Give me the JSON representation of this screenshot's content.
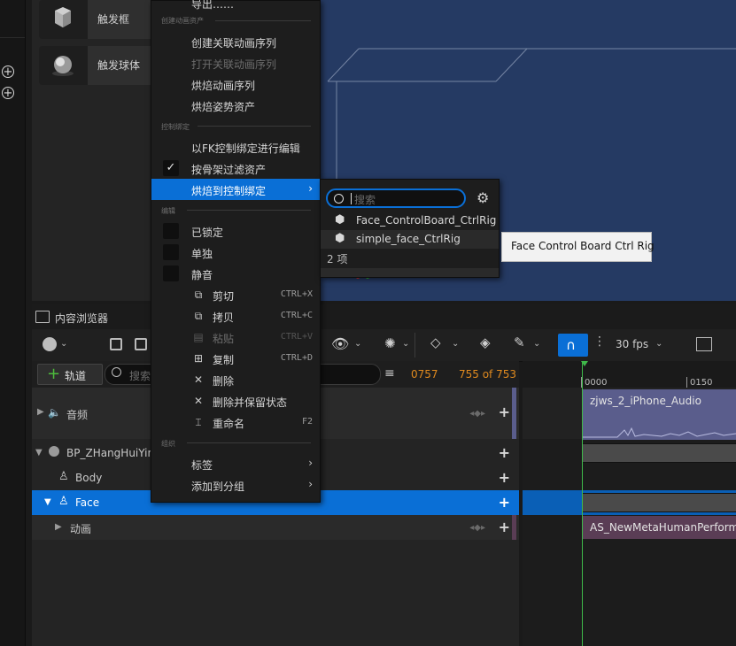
{
  "place_actors": {
    "items": [
      {
        "label": "触发框"
      },
      {
        "label": "触发球体"
      }
    ]
  },
  "content_browser": {
    "tab_label": "内容浏览器"
  },
  "sequencer": {
    "add_track_label": "轨道",
    "search_placeholder": "搜索",
    "frame_current": "0757",
    "frame_count": "755 of 753",
    "fps_label": "30 fps",
    "ruler": {
      "tick_0": "0000",
      "tick_1": "0150"
    },
    "tracks": [
      {
        "label": "音频"
      },
      {
        "label": "BP_ZHangHuiYin"
      },
      {
        "label": "Body"
      },
      {
        "label": "Face"
      },
      {
        "label": "动画"
      }
    ],
    "clips": {
      "audio": "zjws_2_iPhone_Audio",
      "anim": "AS_NewMetaHumanPerform"
    }
  },
  "context_menu": {
    "top_cut_label": "导出……",
    "sections": {
      "anim_assets": "创建动画资产",
      "control_rig": "控制绑定",
      "edit": "编辑",
      "organize": "组织"
    },
    "items": {
      "create_linked_seq": "创建关联动画序列",
      "open_linked_seq": "打开关联动画序列",
      "bake_anim_seq": "烘焙动画序列",
      "bake_pose_asset": "烘焙姿势资产",
      "edit_with_fk": "以FK控制绑定进行编辑",
      "filter_by_skeleton": "按骨架过滤资产",
      "bake_to_control_rig": "烘焙到控制绑定",
      "locked": "已锁定",
      "solo": "单独",
      "mute": "静音",
      "cut": "剪切",
      "copy": "拷贝",
      "paste": "粘贴",
      "duplicate": "复制",
      "delete": "删除",
      "delete_keep_state": "删除并保留状态",
      "rename": "重命名",
      "tags": "标签",
      "add_to_group": "添加到分组"
    },
    "shortcuts": {
      "cut": "CTRL+X",
      "copy": "CTRL+C",
      "paste": "CTRL+V",
      "duplicate": "CTRL+D",
      "rename": "F2"
    }
  },
  "submenu": {
    "search_placeholder": "搜索",
    "items": [
      {
        "label": "Face_ControlBoard_CtrlRig"
      },
      {
        "label": "simple_face_CtrlRig"
      }
    ],
    "count_label": "2 项"
  },
  "tooltip": {
    "text": "Face Control Board Ctrl Rig"
  },
  "colors": {
    "accent_blue": "#0a6fd6",
    "frame_orange": "#e08a1e",
    "viewport_blue": "#253a63",
    "audio_clip": "#5a5d8c",
    "anim_clip": "#5a3d55",
    "playhead_green": "#3fb94a"
  }
}
